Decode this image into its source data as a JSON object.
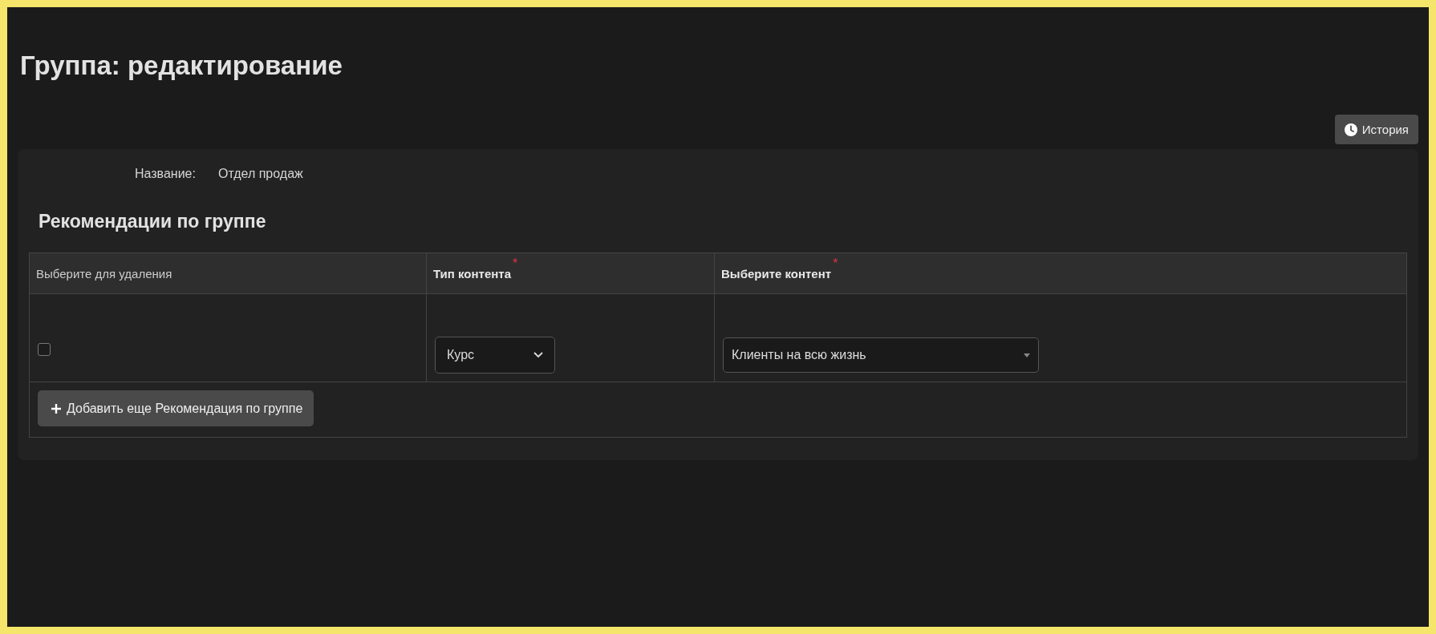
{
  "title": "Группа: редактирование",
  "history_button": {
    "label": "История"
  },
  "fields": [
    {
      "label": "Название:",
      "value": "Отдел продаж"
    }
  ],
  "section": {
    "title": "Рекомендации по группе",
    "table": {
      "columns": [
        {
          "label": "Выберите для удаления",
          "bold": false
        },
        {
          "label": "Тип контента",
          "bold": true,
          "required_mark": "*"
        },
        {
          "label": "Выберите контент",
          "bold": true,
          "required_mark": "*"
        }
      ],
      "rows": [
        {
          "checked": false,
          "content_type": "Курс",
          "content": "Клиенты на всю жизнь"
        }
      ]
    },
    "add_button": {
      "label": "Добавить еще Рекомендация по группе"
    }
  }
}
